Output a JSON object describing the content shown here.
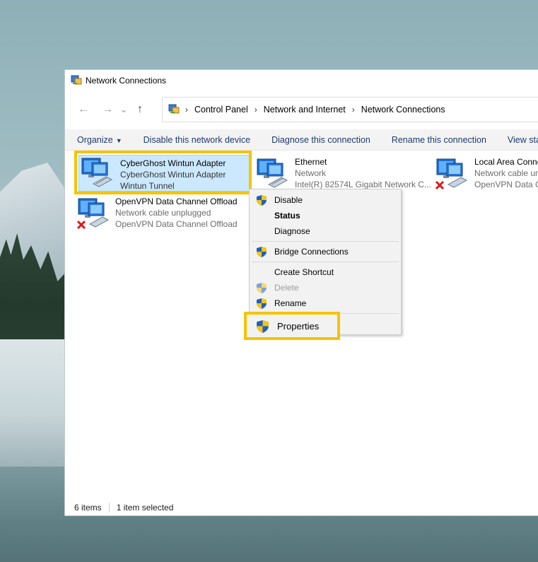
{
  "window": {
    "title": "Network Connections",
    "address": [
      "Control Panel",
      "Network and Internet",
      "Network Connections"
    ]
  },
  "nav": {
    "back": "←",
    "forward": "→",
    "recent": "⌄",
    "up": "↑"
  },
  "commandbar": {
    "organize": "Organize",
    "disable": "Disable this network device",
    "diagnose": "Diagnose this connection",
    "rename": "Rename this connection",
    "view_status": "View status o"
  },
  "items": [
    {
      "name": "CyberGhost Wintun Adapter",
      "status": "CyberGhost Wintun Adapter",
      "device": "Wintun Tunnel",
      "icon": "network-adapter-icon"
    },
    {
      "name": "Ethernet",
      "status": "Network",
      "device": "Intel(R) 82574L Gigabit Network C...",
      "icon": "network-adapter-icon"
    },
    {
      "name": "Local Area Conne",
      "status": "Network cable ur",
      "device": "OpenVPN Data C",
      "icon": "network-adapter-disconnected-icon"
    },
    {
      "name": "OpenVPN Data Channel Offload",
      "status": "Network cable unplugged",
      "device": "OpenVPN Data Channel Offload",
      "icon": "network-adapter-disconnected-icon"
    }
  ],
  "context_menu": {
    "disable": "Disable",
    "status": "Status",
    "diagnose": "Diagnose",
    "bridge": "Bridge Connections",
    "shortcut": "Create Shortcut",
    "delete": "Delete",
    "rename": "Rename",
    "properties": "Properties"
  },
  "statusbar": {
    "count": "6 items",
    "selected": "1 item selected"
  },
  "colors": {
    "highlight": "#f5c400",
    "selection": "#cce8ff",
    "command_text": "#1e3a6e"
  }
}
